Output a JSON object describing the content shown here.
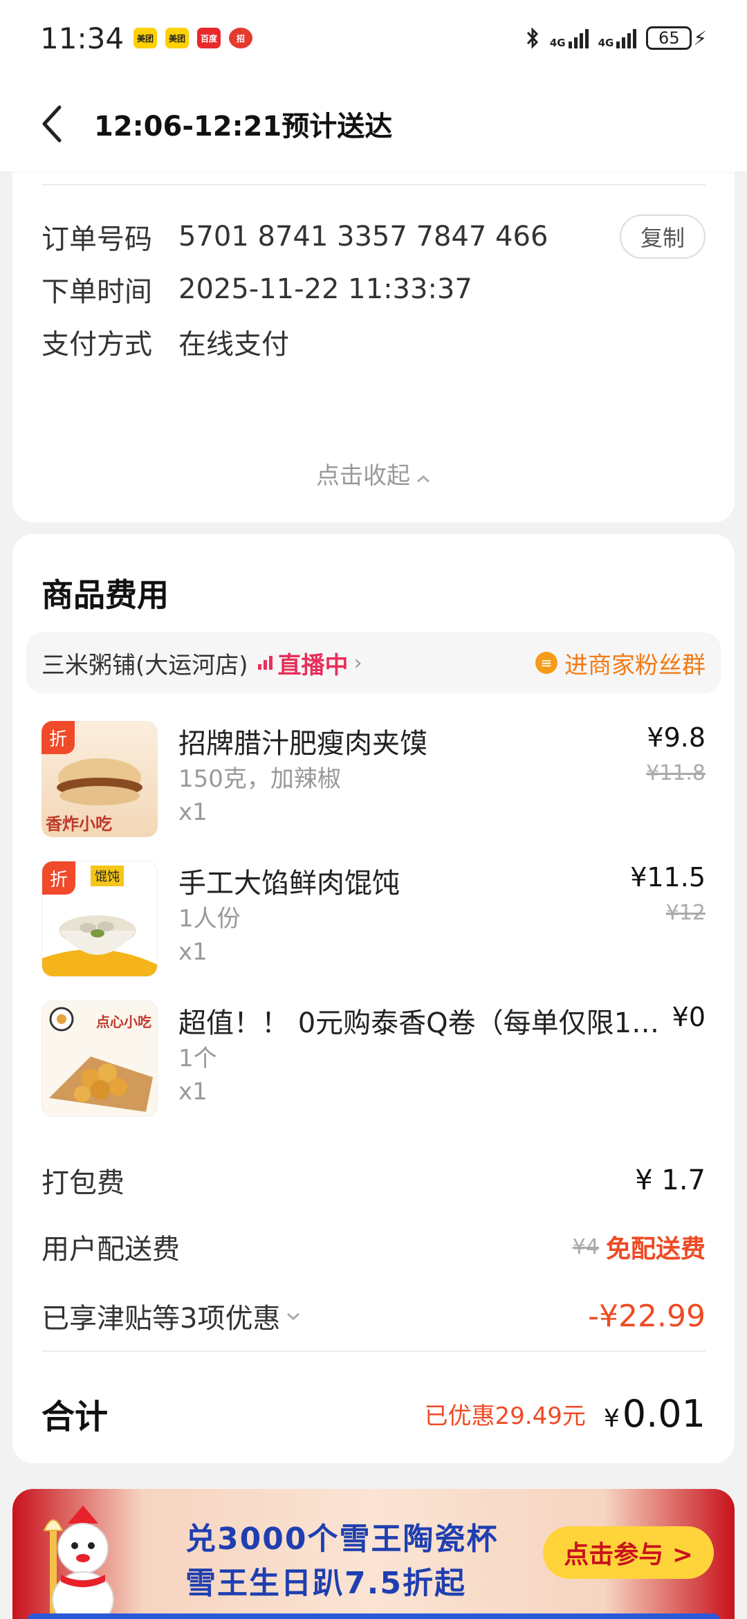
{
  "status_bar": {
    "time": "11:34",
    "apps": [
      {
        "name": "meituan-app-icon",
        "label": "美团",
        "bg": "#ffd100",
        "fg": "#222222"
      },
      {
        "name": "meituan-app-icon-2",
        "label": "美团",
        "bg": "#ffd100",
        "fg": "#222222"
      },
      {
        "name": "baiduwaimai-app-icon",
        "label": "百度",
        "bg": "#e8292a",
        "fg": "#ffffff"
      },
      {
        "name": "china-merchants-bank-icon",
        "label": "招",
        "bg": "#e33b2e",
        "fg": "#ffffff"
      }
    ],
    "network1": "4G",
    "network2": "4G",
    "battery": "65"
  },
  "header": {
    "title": "12:06-12:21预计送达"
  },
  "order_info": {
    "order_no_label": "订单号码",
    "order_no": "5701 8741 3357 7847 466",
    "copy_label": "复制",
    "order_time_label": "下单时间",
    "order_time": "2025-11-22 11:33:37",
    "pay_label": "支付方式",
    "pay_value": "在线支付",
    "collapse_label": "点击收起"
  },
  "goods": {
    "title": "商品费用",
    "shop_name": "三米粥铺(大运河店)",
    "live_label": "直播中",
    "fans_label": "进商家粉丝群",
    "items": [
      {
        "name": "招牌腊汁肥瘦肉夹馍",
        "spec": "150克，加辣椒",
        "qty": "x1",
        "price": "¥9.8",
        "orig": "¥11.8",
        "badge": "折",
        "thumb_text": "香炸小吃"
      },
      {
        "name": "手工大馅鲜肉馄饨",
        "spec": "1人份",
        "qty": "x1",
        "price": "¥11.5",
        "orig": "¥12",
        "badge": "折",
        "thumb_text": "馄饨"
      },
      {
        "name": "超值！！ 0元购泰香Q卷（每单仅限1…",
        "spec": "1个",
        "qty": "x1",
        "price": "¥0",
        "orig": "",
        "badge": "",
        "thumb_text": "点心小吃"
      }
    ]
  },
  "fees": {
    "packing_label": "打包费",
    "packing_value": "¥ 1.7",
    "delivery_label": "用户配送费",
    "delivery_orig": "¥4",
    "delivery_free": "免配送费",
    "discount_label": "已享津贴等3项优惠",
    "discount_value": "-¥22.99",
    "total_label": "合计",
    "saved_text": "已优惠29.49元",
    "total_currency": "¥",
    "total_value": "0.01"
  },
  "banner": {
    "line1": "兑3000个雪王陶瓷杯",
    "line2": "雪王生日趴7.5折起",
    "button": "点击参与 >"
  },
  "colors": {
    "accent_red": "#ef4a24",
    "live_pink": "#e8305a",
    "fans_orange": "#f27a14",
    "banner_blue": "#1f3fb0"
  }
}
